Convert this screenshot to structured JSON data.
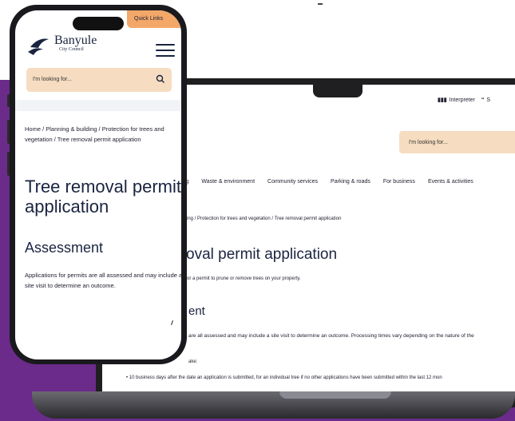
{
  "laptop": {
    "utility": {
      "interpreter_label": "Interpreter",
      "interpreter_icon": "three-bars-icon",
      "quote_icon": "quote-icon",
      "quote_label": "S"
    },
    "search_placeholder": "I'm looking for...",
    "nav": [
      "ilding",
      "Waste & environment",
      "Community services",
      "Parking & roads",
      "For business",
      "Events & activities"
    ],
    "breadcrumb": "ilding  /  Protection for trees and vegetation  /  Tree removal permit application",
    "title": "oval permit application",
    "intro": "or a permit to prune or remove trees on your property.",
    "subtitle": "ent",
    "body": "are all assessed and may include a site visit to determine an outcome. Processing times vary depending on the nature of the",
    "take": "ake:",
    "bullet": "•  10 business days after the date an application is submitted, for an individual tree if no other applications have been submitted within the last 12 mon"
  },
  "phone": {
    "quick_links": "Quick Links",
    "logo": {
      "name": "Banyule",
      "sub": "City Council"
    },
    "search_placeholder": "I'm looking for...",
    "breadcrumb": "Home  /  Planning & building  /  Protection for trees and vegetation  /  Tree removal permit application",
    "title": "Tree removal permit application",
    "subtitle": "Assessment",
    "body": "Applications for permits are all assessed and may include a site visit to determine an outcome."
  },
  "colors": {
    "purple": "#6b2b8a",
    "search_bg": "#f6dcc0",
    "quick_links_bg": "#f3a86a",
    "navy": "#1a2440"
  }
}
